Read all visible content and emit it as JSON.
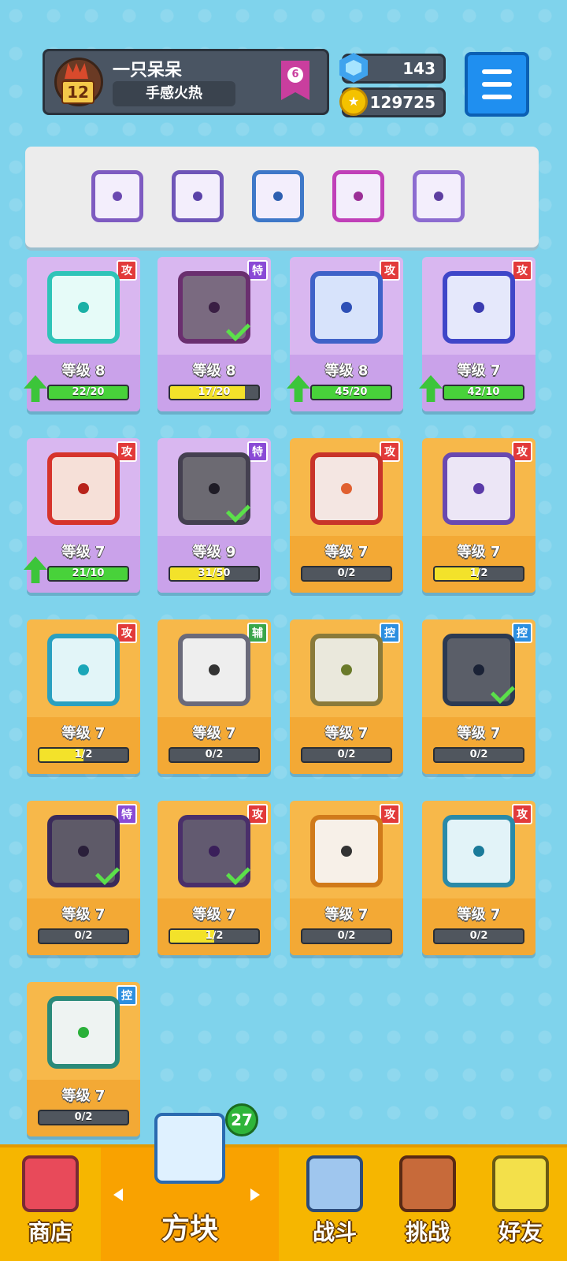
{
  "profile": {
    "name": "一只呆呆",
    "title": "手感火热",
    "level": "12",
    "rank": "6"
  },
  "currency": {
    "gems": "143",
    "coins": "129725"
  },
  "deck": [
    {
      "icon": "purple-dragon-die-icon",
      "color": "#7e5bc1",
      "dot": "#6a49b0"
    },
    {
      "icon": "purple-dragon-die-icon",
      "color": "#6e55b8",
      "dot": "#5a42a8"
    },
    {
      "icon": "snowflake-die-icon",
      "color": "#3e78c8",
      "dot": "#2d5fb0"
    },
    {
      "icon": "compass-die-icon",
      "color": "#c040b8",
      "dot": "#9b2f96"
    },
    {
      "icon": "cracked-die-icon",
      "color": "#8c6cd0",
      "dot": "#5d3ea0"
    }
  ],
  "cards": [
    {
      "tag": "攻",
      "tagType": "atk",
      "level": "等级 8",
      "progress": "22/20",
      "fill": 1.0,
      "bar": "green",
      "upgrade": true,
      "bg": "purple",
      "border": "#2fc4b8",
      "face": "#e6fbf8",
      "dot": "#1ab0a6",
      "check": false,
      "icon": "wind-die-icon"
    },
    {
      "tag": "特",
      "tagType": "spc",
      "level": "等级 8",
      "progress": "17/20",
      "fill": 0.85,
      "bar": "yellow",
      "upgrade": false,
      "bg": "purple",
      "border": "#6a2f6f",
      "face": "#7a6a80",
      "dot": "#3a1f44",
      "check": true,
      "icon": "arrow-die-icon"
    },
    {
      "tag": "攻",
      "tagType": "atk",
      "level": "等级 8",
      "progress": "45/20",
      "fill": 1.0,
      "bar": "green",
      "upgrade": true,
      "bg": "purple",
      "border": "#3f62c8",
      "face": "#d7e3fb",
      "dot": "#2d4fb6",
      "check": false,
      "icon": "gear-die-icon"
    },
    {
      "tag": "攻",
      "tagType": "atk",
      "level": "等级 7",
      "progress": "42/10",
      "fill": 1.0,
      "bar": "green",
      "upgrade": true,
      "bg": "purple",
      "border": "#3f46c8",
      "face": "#e5e8fb",
      "dot": "#3a3bb0",
      "check": false,
      "icon": "bubble-die-icon"
    },
    {
      "tag": "攻",
      "tagType": "atk",
      "level": "等级 7",
      "progress": "21/10",
      "fill": 1.0,
      "bar": "green",
      "upgrade": true,
      "bg": "purple",
      "border": "#d6342c",
      "face": "#f6e0d8",
      "dot": "#b8231b",
      "check": false,
      "icon": "fire-die-icon"
    },
    {
      "tag": "特",
      "tagType": "spc",
      "level": "等级 9",
      "progress": "31/50",
      "fill": 0.62,
      "bar": "yellow",
      "upgrade": false,
      "bg": "purple",
      "border": "#444050",
      "face": "#6c6a72",
      "dot": "#1f1c26",
      "check": true,
      "icon": "cracked-die-icon"
    },
    {
      "tag": "攻",
      "tagType": "atk",
      "level": "等级 7",
      "progress": "0/2",
      "fill": 0.0,
      "bar": "yellow",
      "upgrade": false,
      "bg": "orange",
      "border": "#c8342a",
      "face": "#f4e6e2",
      "dot": "#e06030",
      "check": false,
      "icon": "red-dragon-die-icon"
    },
    {
      "tag": "攻",
      "tagType": "atk",
      "level": "等级 7",
      "progress": "1/2",
      "fill": 0.5,
      "bar": "yellow",
      "upgrade": false,
      "bg": "orange",
      "border": "#6a49b0",
      "face": "#ece6f6",
      "dot": "#5a3aa8",
      "check": false,
      "icon": "purple-dragon-die-icon"
    },
    {
      "tag": "攻",
      "tagType": "atk",
      "level": "等级 7",
      "progress": "1/2",
      "fill": 0.5,
      "bar": "yellow",
      "upgrade": false,
      "bg": "orange",
      "border": "#2aa0c0",
      "face": "#e2f5f8",
      "dot": "#1aa6b8",
      "check": false,
      "icon": "teal-dragon-die-icon"
    },
    {
      "tag": "辅",
      "tagType": "sup",
      "level": "等级 7",
      "progress": "0/2",
      "fill": 0.0,
      "bar": "yellow",
      "upgrade": false,
      "bg": "orange",
      "border": "#6a6a7a",
      "face": "#eeeeee",
      "dot": "#333333",
      "check": false,
      "icon": "gray-dragon-die-icon"
    },
    {
      "tag": "控",
      "tagType": "ctl",
      "level": "等级 7",
      "progress": "0/2",
      "fill": 0.0,
      "bar": "yellow",
      "upgrade": false,
      "bg": "orange",
      "border": "#8a7a3a",
      "face": "#eae8dc",
      "dot": "#6a7a2a",
      "check": false,
      "icon": "gold-dragon-die-icon"
    },
    {
      "tag": "控",
      "tagType": "ctl",
      "level": "等级 7",
      "progress": "0/2",
      "fill": 0.0,
      "bar": "yellow",
      "upgrade": false,
      "bg": "orange",
      "border": "#2c3a52",
      "face": "#5a5e68",
      "dot": "#1a2236",
      "check": true,
      "icon": "dark-snowflake-die-icon"
    },
    {
      "tag": "特",
      "tagType": "spc",
      "level": "等级 7",
      "progress": "0/2",
      "fill": 0.0,
      "bar": "yellow",
      "upgrade": false,
      "bg": "orange",
      "border": "#3a2a5a",
      "face": "#5e5a68",
      "dot": "#2a1f3a",
      "check": true,
      "icon": "dark-purple-dragon-die-icon"
    },
    {
      "tag": "攻",
      "tagType": "atk",
      "level": "等级 7",
      "progress": "1/2",
      "fill": 0.5,
      "bar": "yellow",
      "upgrade": false,
      "bg": "orange",
      "border": "#4a2f6a",
      "face": "#625a70",
      "dot": "#3a1f5a",
      "check": true,
      "icon": "dark-atom-die-icon"
    },
    {
      "tag": "攻",
      "tagType": "atk",
      "level": "等级 7",
      "progress": "0/2",
      "fill": 0.0,
      "bar": "yellow",
      "upgrade": false,
      "bg": "orange",
      "border": "#d07a1a",
      "face": "#f7f0e8",
      "dot": "#333333",
      "check": false,
      "icon": "gun-die-icon"
    },
    {
      "tag": "攻",
      "tagType": "atk",
      "level": "等级 7",
      "progress": "0/2",
      "fill": 0.0,
      "bar": "yellow",
      "upgrade": false,
      "bg": "orange",
      "border": "#2a8aa8",
      "face": "#e2f3f8",
      "dot": "#1a7a9a",
      "check": false,
      "icon": "vortex-die-icon"
    },
    {
      "tag": "控",
      "tagType": "ctl",
      "level": "等级 7",
      "progress": "0/2",
      "fill": 0.0,
      "bar": "yellow",
      "upgrade": false,
      "bg": "orange",
      "border": "#2a8a7a",
      "face": "#eef3f2",
      "dot": "#2ab03a",
      "check": false,
      "icon": "green-dragon-die-icon"
    }
  ],
  "nav": {
    "shop": "商店",
    "dice": "方块",
    "battle": "战斗",
    "challenge": "挑战",
    "friends": "好友",
    "dice_badge": "27"
  }
}
